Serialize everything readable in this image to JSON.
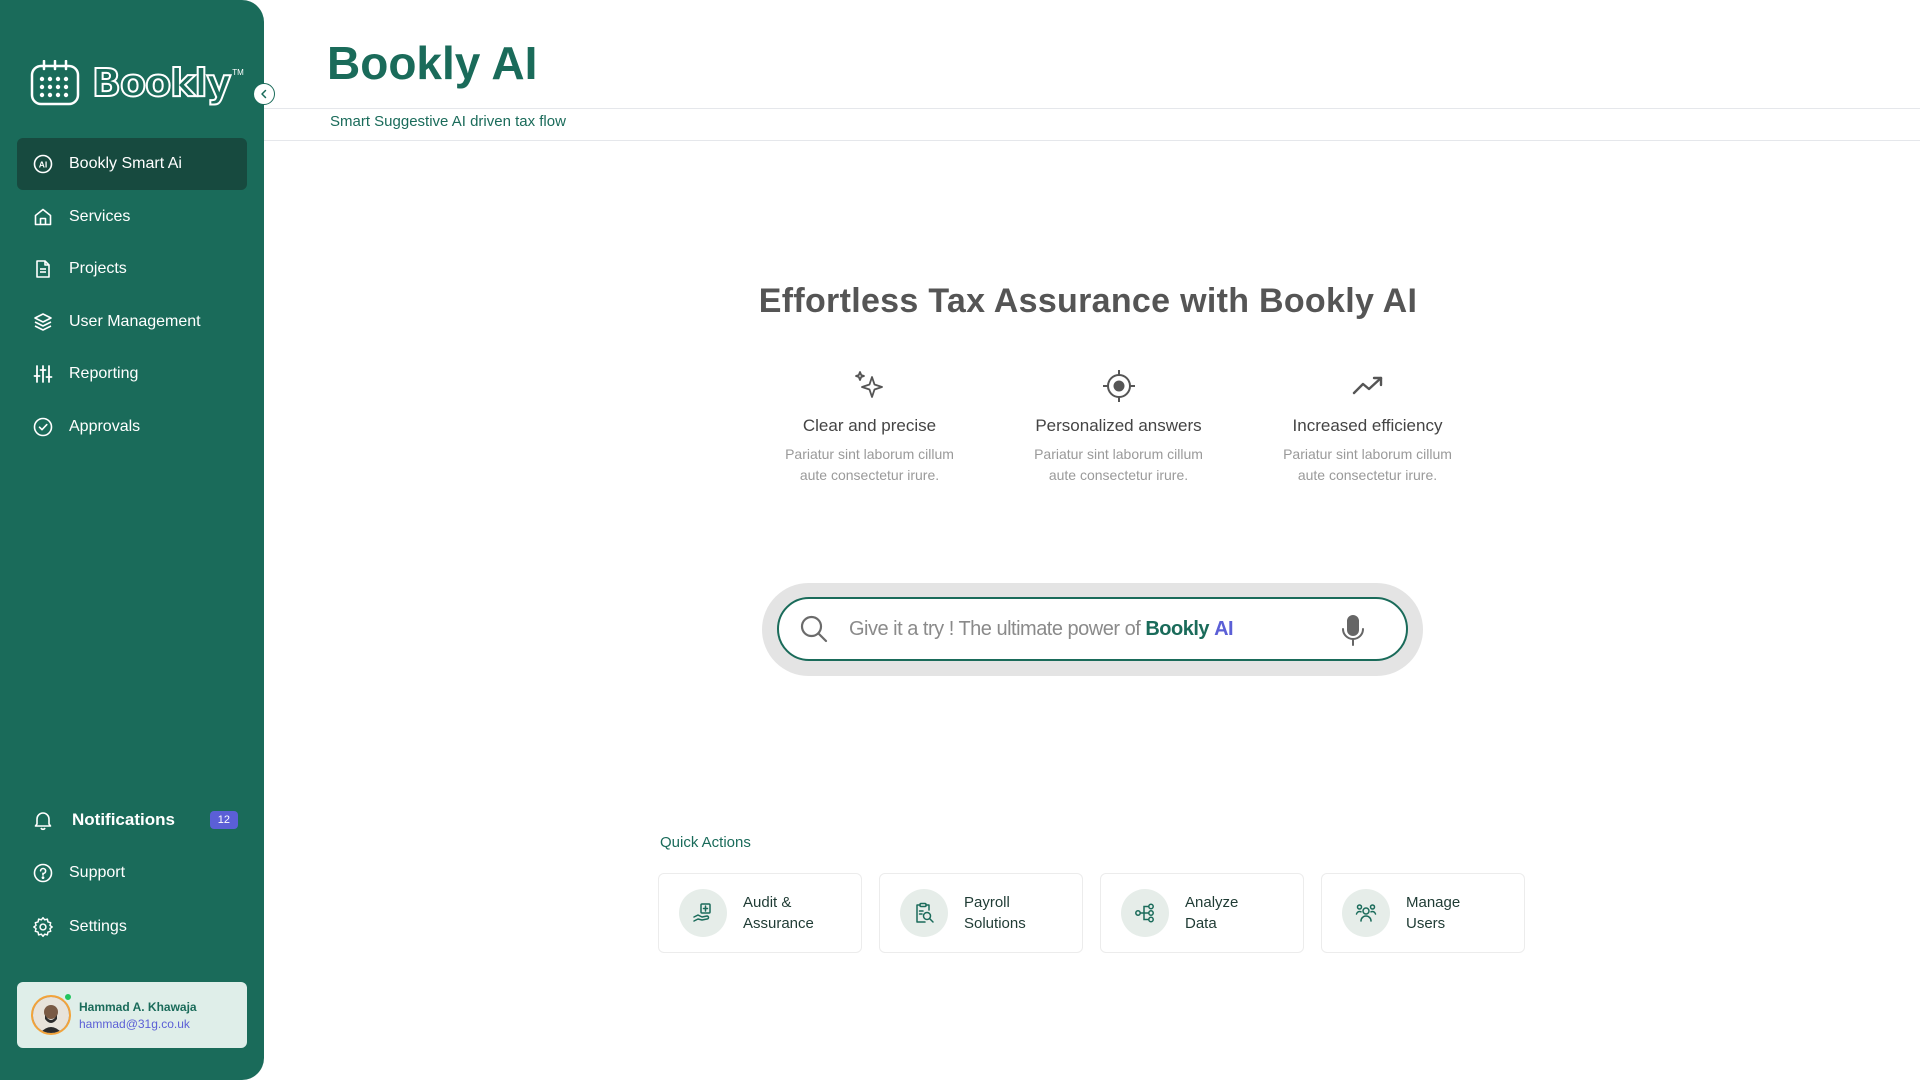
{
  "sidebar": {
    "logo_text": "Bookly",
    "logo_tm": "TM",
    "items": [
      {
        "label": "Bookly Smart Ai",
        "icon": "ai-icon",
        "active": true
      },
      {
        "label": "Services",
        "icon": "home-icon"
      },
      {
        "label": "Projects",
        "icon": "document-icon"
      },
      {
        "label": "User Management",
        "icon": "layers-icon"
      },
      {
        "label": "Reporting",
        "icon": "sliders-icon"
      },
      {
        "label": "Approvals",
        "icon": "check-circle-icon"
      }
    ],
    "bottom": {
      "notifications_label": "Notifications",
      "notifications_count": "12",
      "support_label": "Support",
      "settings_label": "Settings"
    },
    "user": {
      "name": "Hammad A. Khawaja",
      "email": "hammad@31g.co.uk"
    }
  },
  "header": {
    "title": "Bookly AI",
    "subtitle": "Smart Suggestive AI driven tax flow"
  },
  "hero": {
    "title": "Effortless Tax Assurance with Bookly AI",
    "features": [
      {
        "title": "Clear and precise",
        "desc_line1": "Pariatur sint laborum cillum",
        "desc_line2": "aute consectetur irure.",
        "icon": "sparkle-icon"
      },
      {
        "title": "Personalized answers",
        "desc_line1": "Pariatur sint laborum cillum",
        "desc_line2": "aute consectetur irure.",
        "icon": "target-icon"
      },
      {
        "title": "Increased efficiency",
        "desc_line1": "Pariatur sint laborum cillum",
        "desc_line2": "aute consectetur irure.",
        "icon": "trending-up-icon"
      }
    ]
  },
  "search": {
    "prefix": "Give it a try ! The ultimate power of",
    "brand_bookly": "Bookly",
    "brand_ai": "AI"
  },
  "quick_actions": {
    "label": "Quick Actions",
    "items": [
      {
        "line1": "Audit &",
        "line2": "Assurance",
        "icon": "audit-icon"
      },
      {
        "line1": "Payroll",
        "line2": "Solutions",
        "icon": "payroll-icon"
      },
      {
        "line1": "Analyze",
        "line2": "Data",
        "icon": "analyze-icon"
      },
      {
        "line1": "Manage",
        "line2": "Users",
        "icon": "users-icon"
      }
    ]
  },
  "colors": {
    "brand": "#1a6b5a",
    "active_nav": "#174a3f",
    "accent": "#5b5fd6"
  }
}
